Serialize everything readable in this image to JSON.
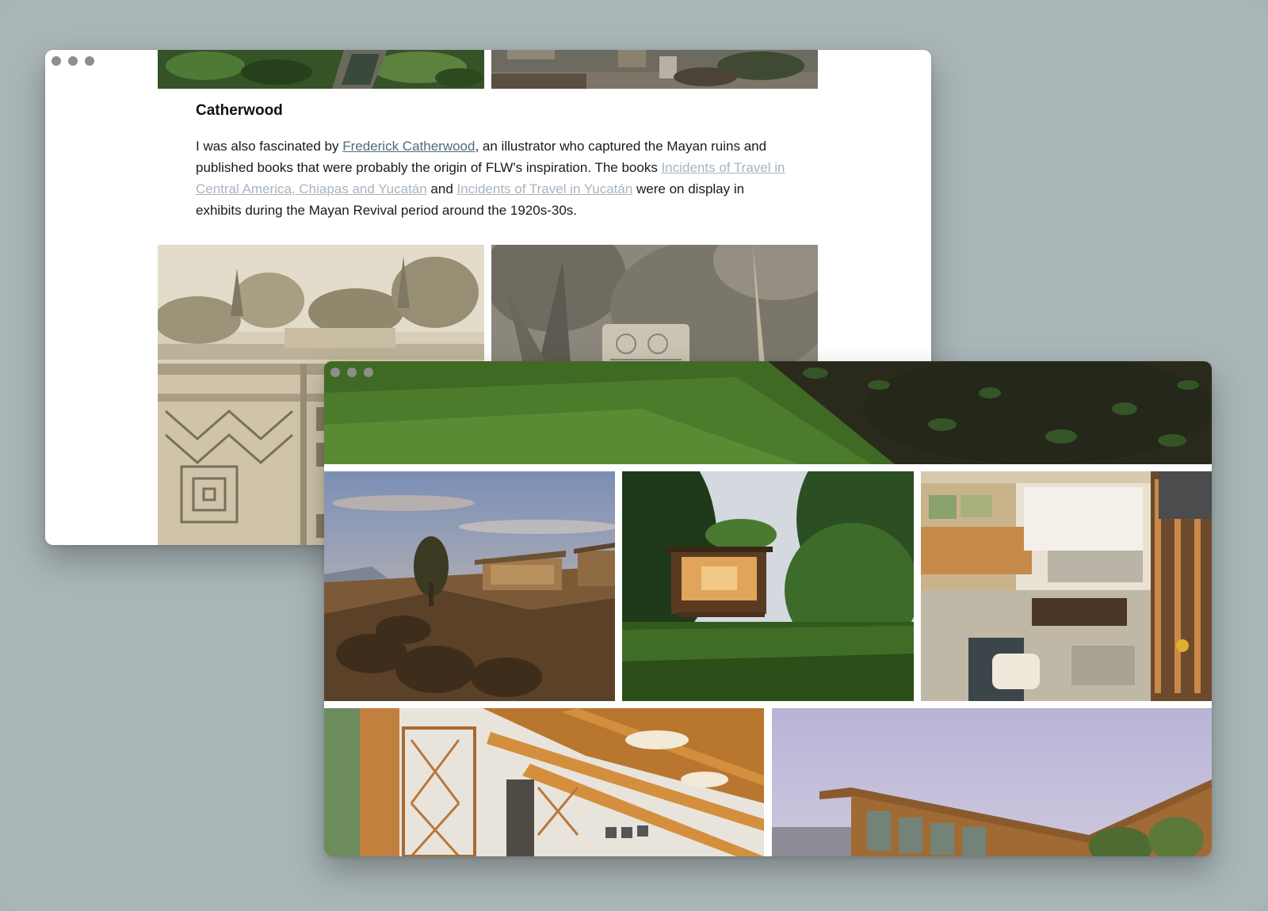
{
  "article": {
    "heading": "Catherwood",
    "para_1": "I was also fascinated by ",
    "link_catherwood": "Frederick Catherwood",
    "para_2": ", an illustrator who captured the Mayan ruins and published books that were probably the origin of FLW's inspiration. The books ",
    "link_book_1": "Incidents of Travel in Central America, Chiapas and Yucatán",
    "para_3": " and ",
    "link_book_2": "Incidents of Travel in Yucatán",
    "para_4": " were on display in exhibits during the Mayan Revival period around the 1920s-30s."
  },
  "colors": {
    "background": "#a9b5b7",
    "link": "#4e6b7d",
    "link_muted": "#a7b4c1",
    "window_dot": "#8e8e8e"
  },
  "icons": [
    "window-control-dot"
  ]
}
